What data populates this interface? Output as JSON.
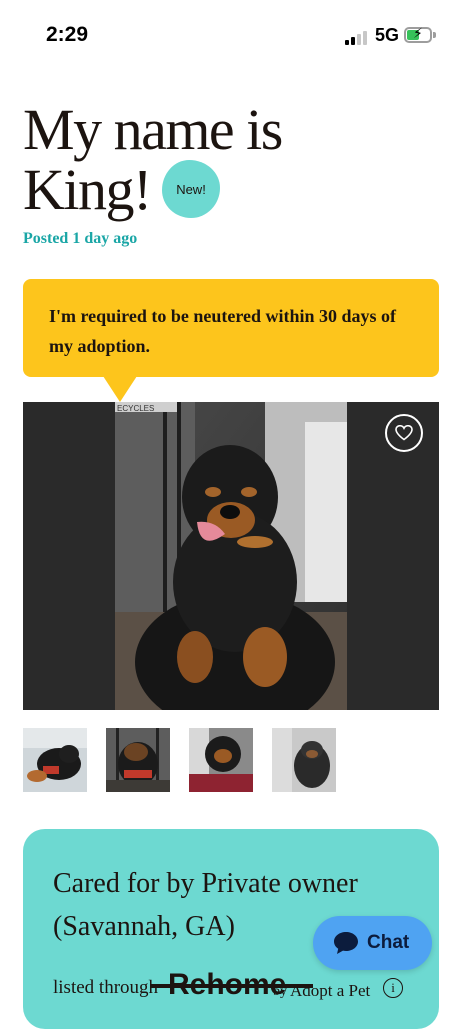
{
  "status_bar": {
    "time": "2:29",
    "network": "5G",
    "icons": [
      "cellular-signal-icon",
      "battery-charging-icon"
    ]
  },
  "listing": {
    "title": "My name is King!",
    "badge": "New!",
    "posted": "Posted 1 day ago",
    "notice": "I'm required to be neutered within 30 days of my adoption.",
    "photo_count": 4,
    "favorite_icon": "heart-outline-icon"
  },
  "care": {
    "title": "Cared for by Private owner (Savannah, GA)",
    "listed_through": "listed through",
    "rehome_logo": "Rehome",
    "by": "by",
    "adoptapet": "Adopt a Pet",
    "info_icon": "i"
  },
  "chat": {
    "label": "Chat",
    "icon": "speech-bubble-icon"
  },
  "colors": {
    "teal": "#6dd9d1",
    "teal_text": "#1aa6a6",
    "yellow": "#fdc51c",
    "chat_blue": "#4fa3f2",
    "ink": "#1c1410"
  }
}
